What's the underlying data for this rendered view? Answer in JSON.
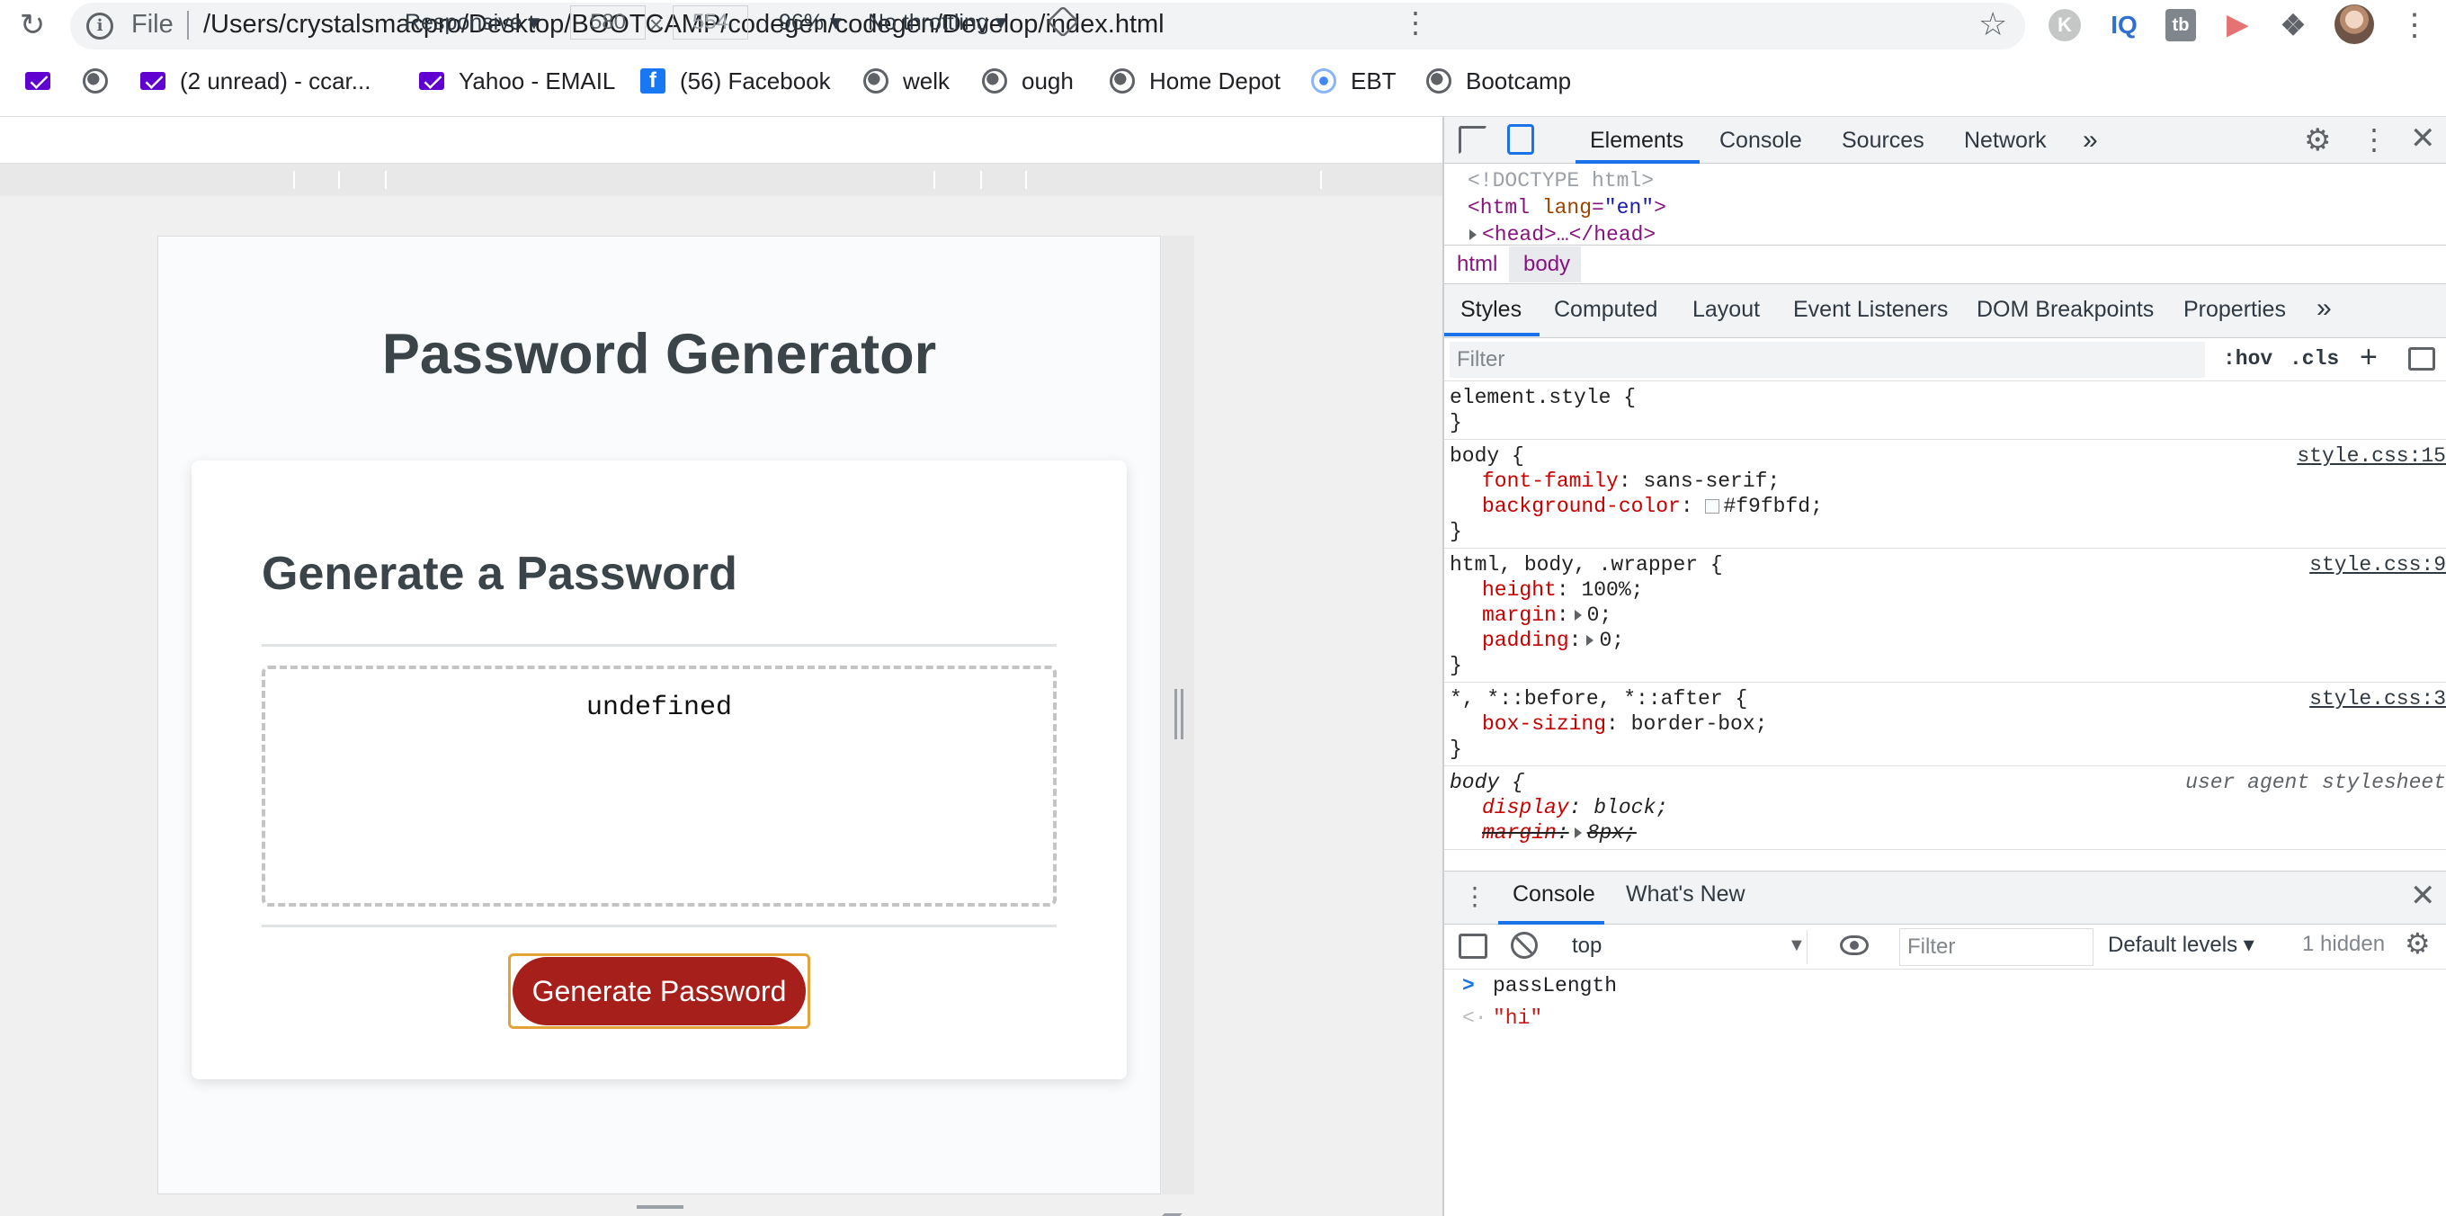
{
  "browser": {
    "file_label": "File",
    "url": "/Users/crystalsmacpro/Desktop/BOOTCAMP/codegen/codegen/Develop/index.html",
    "extensions": [
      "K",
      "IQ",
      "tb",
      "▶",
      "❖"
    ]
  },
  "bookmarks": [
    {
      "icon": "mail-icon",
      "label": ""
    },
    {
      "icon": "globe-icon",
      "label": ""
    },
    {
      "icon": "mail-icon",
      "label": "(2 unread) - ccar..."
    },
    {
      "icon": "mail-icon",
      "label": "Yahoo - EMAIL"
    },
    {
      "icon": "facebook-icon",
      "label": "(56) Facebook"
    },
    {
      "icon": "globe-icon",
      "label": "welk"
    },
    {
      "icon": "globe-icon",
      "label": "ough"
    },
    {
      "icon": "globe-icon",
      "label": "Home Depot"
    },
    {
      "icon": "ebt-icon",
      "label": "EBT"
    },
    {
      "icon": "globe-icon",
      "label": "Bootcamp"
    }
  ],
  "device_toolbar": {
    "device": "Responsive ▾",
    "width": "580",
    "height": "554",
    "times": "×",
    "zoom": "96% ▾",
    "throttling": "No throttling ▾"
  },
  "page": {
    "title": "Password Generator",
    "card_title": "Generate a Password",
    "password_text": "undefined",
    "button_label": "Generate Password",
    "colors": {
      "button": "#a61f1a",
      "text": "#3a4449",
      "background": "#f9fbfd"
    }
  },
  "devtools": {
    "tabs": [
      "Elements",
      "Console",
      "Sources",
      "Network",
      "»"
    ],
    "dom": {
      "doctype": "<!DOCTYPE html>",
      "html_open": "<html",
      "lang_attr": "lang",
      "lang_val": "\"en\"",
      "head": "<head>…</head>"
    },
    "breadcrumbs": [
      "html",
      "body"
    ],
    "style_tabs": [
      "Styles",
      "Computed",
      "Layout",
      "Event Listeners",
      "DOM Breakpoints",
      "Properties",
      "»"
    ],
    "filter_placeholder": "Filter",
    "hov": ":hov",
    "cls": ".cls",
    "rules": [
      {
        "selector": "element.style {",
        "source": "",
        "props": []
      },
      {
        "selector": "body {",
        "source": "style.css:15",
        "props": [
          {
            "name": "font-family",
            "value": "sans-serif;"
          },
          {
            "name": "background-color",
            "value": "#f9fbfd;"
          }
        ]
      },
      {
        "selector": "html, body, .wrapper {",
        "source": "style.css:9",
        "props": [
          {
            "name": "height",
            "value": "100%;"
          },
          {
            "name": "margin",
            "value": "0;"
          },
          {
            "name": "padding",
            "value": "0;"
          }
        ]
      },
      {
        "selector": "*, *::before, *::after {",
        "source": "style.css:3",
        "props": [
          {
            "name": "box-sizing",
            "value": "border-box;"
          }
        ]
      },
      {
        "selector": "body {",
        "source": "user agent stylesheet",
        "props": [
          {
            "name": "display",
            "value": "block;"
          },
          {
            "name": "margin",
            "value": "8px;"
          }
        ]
      }
    ],
    "drawer": {
      "tabs": [
        "Console",
        "What's New"
      ],
      "context": "top",
      "filter_placeholder": "Filter",
      "levels": "Default levels ▾",
      "hidden": "1 hidden",
      "lines": [
        {
          "kind": "input",
          "text": "passLength"
        },
        {
          "kind": "result",
          "text": "\"hi\""
        }
      ]
    }
  }
}
